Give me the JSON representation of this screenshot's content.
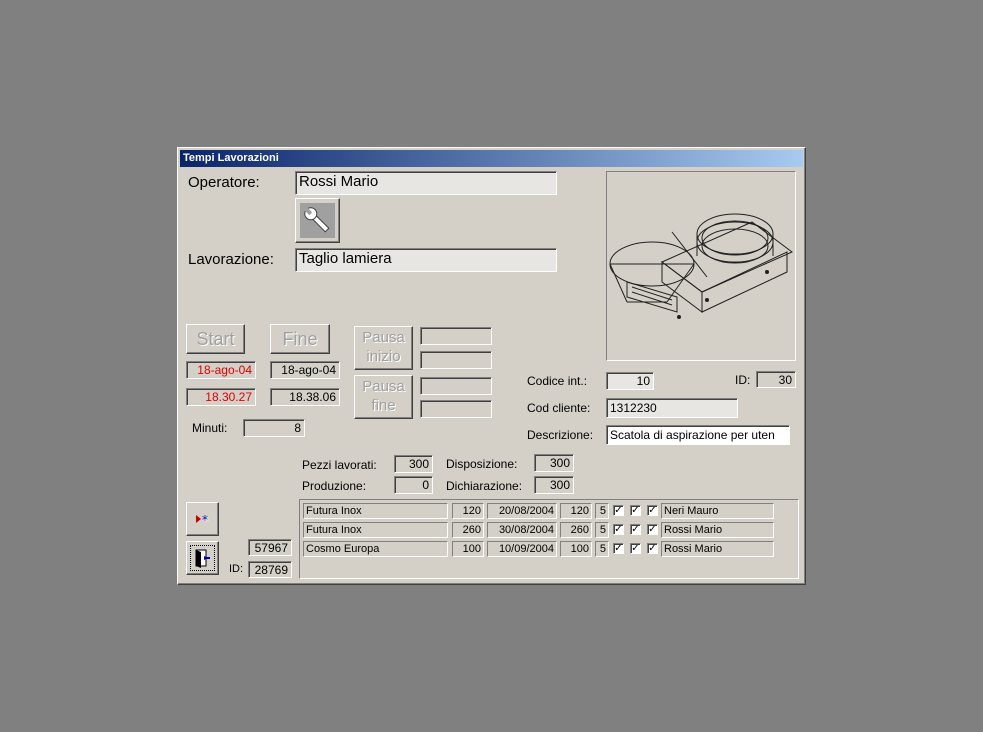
{
  "window": {
    "title": "Tempi Lavorazioni"
  },
  "operatore": {
    "label": "Operatore:",
    "value": "Rossi Mario"
  },
  "lavorazione": {
    "label": "Lavorazione:",
    "value": "Taglio lamiera"
  },
  "buttons": {
    "start": "Start",
    "fine": "Fine",
    "pausa_inizio": [
      "Pausa",
      "inizio"
    ],
    "pausa_fine": [
      "Pausa",
      "fine"
    ]
  },
  "times": {
    "start_date": "18-ago-04",
    "start_time": "18.30.27",
    "end_date": "18-ago-04",
    "end_time": "18.38.06",
    "pausa_inizio": [
      "",
      ""
    ],
    "pausa_fine": [
      "",
      ""
    ]
  },
  "minuti": {
    "label": "Minuti:",
    "value": "8"
  },
  "codice_int": {
    "label": "Codice  int.:",
    "value": "10"
  },
  "id_top": {
    "label": "ID:",
    "value": "30"
  },
  "cod_cliente": {
    "label": "Cod cliente:",
    "value": "1312230"
  },
  "descrizione": {
    "label": "Descrizione:",
    "value": "Scatola di aspirazione per uten"
  },
  "pezzi_lavorati": {
    "label": "Pezzi lavorati:",
    "value": "300"
  },
  "produzione": {
    "label": "Produzione:",
    "value": "0"
  },
  "disposizione": {
    "label": "Disposizione:",
    "value": "300"
  },
  "dichiarazione": {
    "label": "Dichiarazione:",
    "value": "300"
  },
  "bottom": {
    "number": "57967",
    "id_label": "ID:",
    "id_value": "28769"
  },
  "icons": {
    "tool": "wrench-icon",
    "new_record": "new-record-icon",
    "exit": "exit-door-icon",
    "product": "product-drawing"
  },
  "rows": [
    {
      "cliente": "Futura Inox",
      "qta": "120",
      "data": "20/08/2004",
      "qta2": "120",
      "n": "5",
      "c1": true,
      "c2": true,
      "c3": true,
      "operatore": "Neri Mauro"
    },
    {
      "cliente": "Futura Inox",
      "qta": "260",
      "data": "30/08/2004",
      "qta2": "260",
      "n": "5",
      "c1": true,
      "c2": true,
      "c3": true,
      "operatore": "Rossi Mario"
    },
    {
      "cliente": "Cosmo Europa",
      "qta": "100",
      "data": "10/09/2004",
      "qta2": "100",
      "n": "5",
      "c1": true,
      "c2": true,
      "c3": true,
      "operatore": "Rossi Mario"
    }
  ],
  "colors": {
    "title_start": "#0a246a",
    "title_end": "#a6caf0",
    "red_text": "#e00000",
    "face": "#d4d0c8",
    "desktop": "#808080"
  }
}
